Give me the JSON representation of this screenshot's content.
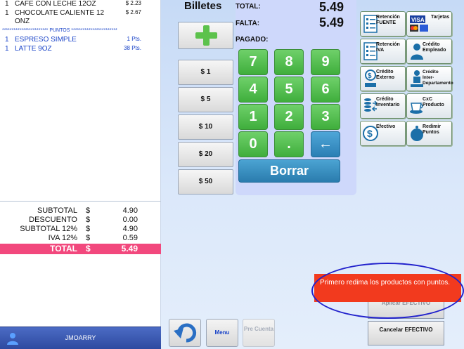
{
  "receipt": {
    "items": [
      {
        "qty": "1",
        "desc": "CAFE CON LECHE 12OZ",
        "price": "$ 2.23"
      },
      {
        "qty": "1",
        "desc": "CHOCOLATE CALIENTE 12",
        "price": "$ 2.67"
      },
      {
        "qty": "",
        "desc": "ONZ",
        "price": ""
      }
    ],
    "points_header": "************************ PUNTOS ************************",
    "points_items": [
      {
        "qty": "1",
        "desc": "ESPRESO SIMPLE",
        "pts": "1 Pts."
      },
      {
        "qty": "1",
        "desc": "LATTE 9OZ",
        "pts": "38 Pts."
      }
    ],
    "totals": [
      {
        "label": "SUBTOTAL",
        "cur": "$",
        "value": "4.90"
      },
      {
        "label": "DESCUENTO",
        "cur": "$",
        "value": "0.00"
      },
      {
        "label": "SUBTOTAL 12%",
        "cur": "$",
        "value": "4.90"
      },
      {
        "label": "IVA 12%",
        "cur": "$",
        "value": "0.59"
      },
      {
        "label": "TOTAL",
        "cur": "$",
        "value": "5.49"
      }
    ],
    "user": "JMOARRY"
  },
  "billetes": {
    "title": "Billetes",
    "bills": [
      "$ 1",
      "$ 5",
      "$ 10",
      "$ 20",
      "$ 50"
    ]
  },
  "summary": {
    "total_label": "TOTAL:",
    "total_value": "5.49",
    "falta_label": "FALTA:",
    "falta_value": "5.49",
    "pagado_label": "PAGADO:"
  },
  "keypad": {
    "keys": [
      "7",
      "8",
      "9",
      "4",
      "5",
      "6",
      "1",
      "2",
      "3",
      "0",
      ".",
      "←"
    ],
    "clear_label": "Borrar"
  },
  "payment_methods": [
    {
      "label": "Retención FUENTE",
      "icon": "checklist-icon"
    },
    {
      "label": "Tarjetas",
      "icon": "credit-cards-icon"
    },
    {
      "label": "Retención IVA",
      "icon": "checklist-icon"
    },
    {
      "label": "Crédito Empleado",
      "icon": "employee-icon"
    },
    {
      "label": "Crédito Externo",
      "icon": "external-credit-icon"
    },
    {
      "label": "Crédito Inter-Departamento",
      "icon": "department-icon"
    },
    {
      "label": "Crédito Inventario",
      "icon": "inventory-icon"
    },
    {
      "label": "CxC Producto",
      "icon": "coffee-cup-icon"
    },
    {
      "label": "Efectivo",
      "icon": "cash-icon"
    },
    {
      "label": "Redimir Puntos",
      "icon": "points-icon"
    }
  ],
  "bottom": {
    "menu_label": "Menu",
    "precuenta_label": "Pre Cuenta",
    "aplicar_label": "Aplicar EFECTIVO",
    "cancelar_label": "Cancelar EFECTIVO",
    "toast": "Primero redima los productos con puntos."
  },
  "colors": {
    "accent_green": "#4cbf48",
    "accent_blue": "#2f86bd",
    "total_pink": "#f2487d",
    "toast_red": "#f23a1e"
  }
}
